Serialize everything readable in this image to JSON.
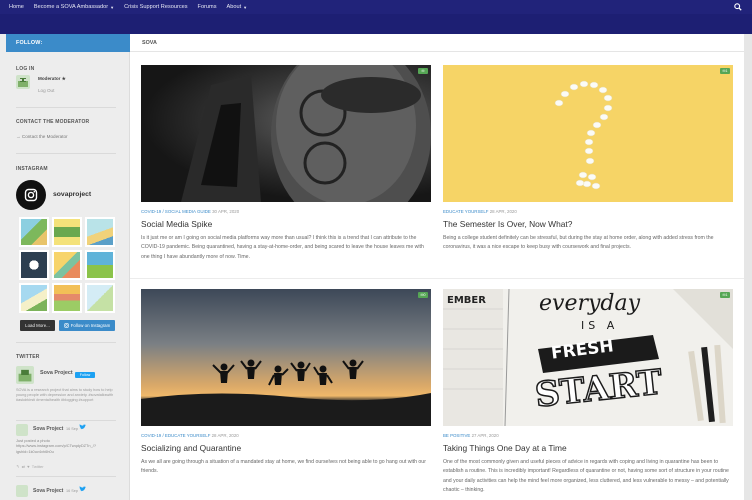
{
  "nav": {
    "items": [
      "Home",
      "Become a SOVA Ambassador",
      "Crisis Support Resources",
      "Forums",
      "About"
    ],
    "has_dropdown": [
      false,
      true,
      false,
      false,
      true
    ],
    "search_icon": "search-icon"
  },
  "sidebar": {
    "follow_label": "FOLLOW:",
    "login": {
      "title": "LOG IN",
      "user": "Moderator ★",
      "logout": "Log Out"
    },
    "contact": {
      "title": "CONTACT THE MODERATOR",
      "link": "→ Contact the Moderator"
    },
    "instagram": {
      "title": "INSTAGRAM",
      "handle": "sovaproject",
      "load_more": "Load More...",
      "follow": "Follow on Instagram"
    },
    "twitter": {
      "title": "TWITTER",
      "account": "Sova Project",
      "follow": "Follow",
      "bio": "SOVA is a research project that aims to study how to help young people with depression and anxiety. #sovatalkswith #askdrkirsti #mentalhealth #blogging #support",
      "tweets": [
        {
          "author": "Sova Project",
          "age": "16 Sep",
          "text": "Just posted a photo https://www.instagram.com/p/CTwqdyDZTn_/?igshid=1k0uv4xh6h0u",
          "actions": "Twitter"
        },
        {
          "author": "Sova Project",
          "age": "16 Sep"
        }
      ]
    }
  },
  "main": {
    "breadcrumb": "SOVA",
    "posts": [
      {
        "categories": "COVID-19 / SOCIAL MEDIA GUIDE",
        "date": "30 APR, 2020",
        "title": "Social Media Spike",
        "comments": "0",
        "excerpt": "Is it just me or am I going on social media platforms way more than usual? I think this is a trend that I can attribute to the COVID-19 pandemic. Being quarantined, having a stay-at-home-order, and being scared to leave the house leaves me with one thing I have abundantly more of now. Time."
      },
      {
        "categories": "EDUCATE YOURSELF",
        "date": "28 APR, 2020",
        "title": "The Semester Is Over, Now What?",
        "comments": "1",
        "excerpt": "Being a college student definitely can be stressful, but during the stay at home order, along with added stress from the coronavirus, it was a nice escape to keep busy with coursework and final projects."
      },
      {
        "categories": "COVID-19 / EDUCATE YOURSELF",
        "date": "28 APR, 2020",
        "title": "Socializing and Quarantine",
        "comments": "0",
        "excerpt": "As we all are going through a situation of a mandated stay at home, we find ourselves not being able to go hang out with our friends."
      },
      {
        "categories": "BE POSITIVE",
        "date": "27 APR, 2020",
        "title": "Taking Things One Day at a Time",
        "comments": "1",
        "excerpt": "One of the most commonly given and useful pieces of advice in regards with coping and living in quarantine has been to establish a routine. This is incredibly important! Regardless of quarantine or not, having some sort of structure in your routine and your daily activities can help the mind feel more organized, less cluttered, and less vulnerable to messy – and potentially chaotic – thinking.",
        "image_text": [
          "everyday",
          "IS A",
          "FRESH",
          "START"
        ]
      }
    ]
  },
  "colors": {
    "nav_bg": "#21237a",
    "accent": "#3b8bc9",
    "comment_badge": "#56a655"
  }
}
